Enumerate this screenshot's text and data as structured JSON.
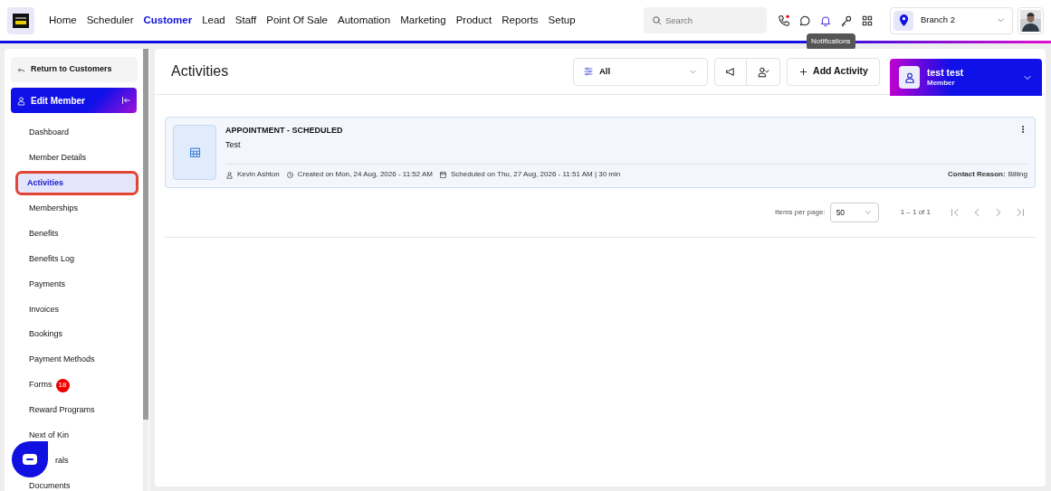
{
  "nav": {
    "items": [
      {
        "label": "Home",
        "selected": false
      },
      {
        "label": "Scheduler",
        "selected": false
      },
      {
        "label": "Customer",
        "selected": true
      },
      {
        "label": "Lead",
        "selected": false
      },
      {
        "label": "Staff",
        "selected": false
      },
      {
        "label": "Point Of Sale",
        "selected": false
      },
      {
        "label": "Automation",
        "selected": false
      },
      {
        "label": "Marketing",
        "selected": false
      },
      {
        "label": "Product",
        "selected": false
      },
      {
        "label": "Reports",
        "selected": false
      },
      {
        "label": "Setup",
        "selected": false
      }
    ],
    "search": {
      "placeholder": "Search"
    },
    "tooltip": "Notifications",
    "branch": "Branch 2"
  },
  "sidebar": {
    "return": "Return to Customers",
    "header": "Edit Member",
    "items": [
      {
        "label": "Dashboard",
        "selected": false
      },
      {
        "label": "Member Details",
        "selected": false
      },
      {
        "label": "Activities",
        "selected": true
      },
      {
        "label": "Memberships",
        "selected": false
      },
      {
        "label": "Benefits",
        "selected": false
      },
      {
        "label": "Benefits Log",
        "selected": false
      },
      {
        "label": "Payments",
        "selected": false
      },
      {
        "label": "Invoices",
        "selected": false
      },
      {
        "label": "Bookings",
        "selected": false
      },
      {
        "label": "Payment Methods",
        "selected": false
      },
      {
        "label": "Forms",
        "selected": false,
        "badge": "18"
      },
      {
        "label": "Reward Programs",
        "selected": false
      },
      {
        "label": "Next of Kin",
        "selected": false
      },
      {
        "label": "rals",
        "selected": false,
        "covered": true
      },
      {
        "label": "Documents",
        "selected": false
      }
    ]
  },
  "main": {
    "title": "Activities",
    "filter": "All",
    "add_button": "Add Activity",
    "member": {
      "name": "test test",
      "role": "Member"
    },
    "activities": [
      {
        "title": "APPOINTMENT - SCHEDULED",
        "subtitle": "Test",
        "staff": "Kevin Ashton",
        "created": "Created on Mon, 24 Aug, 2026 - 11:52 AM",
        "scheduled": "Scheduled on Thu, 27 Aug, 2026 - 11:51 AM | 30 min",
        "reason_label": "Contact Reason:",
        "reason": "Billing"
      }
    ],
    "pagination": {
      "label": "Items per page:",
      "per_page": "50",
      "range": "1 – 1 of 1"
    }
  }
}
